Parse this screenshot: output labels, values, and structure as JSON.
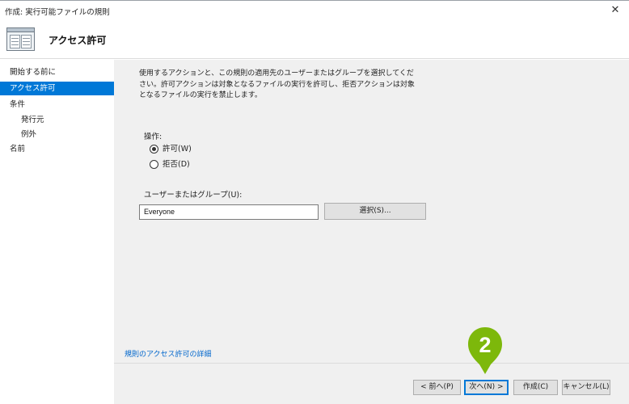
{
  "window": {
    "title": "作成: 実行可能ファイルの規則",
    "close_glyph": "✕"
  },
  "header": {
    "title": "アクセス許可"
  },
  "sidebar": {
    "items": [
      {
        "label": "開始する前に"
      },
      {
        "label": "アクセス許可",
        "active": true
      },
      {
        "label": "条件"
      },
      {
        "label": "発行元"
      },
      {
        "label": "例外"
      },
      {
        "label": "名前"
      }
    ]
  },
  "main": {
    "description": "使用するアクションと、この規則の適用先のユーザーまたはグループを選択してください。許可アクションは対象となるファイルの実行を許可し、拒否アクションは対象となるファイルの実行を禁止します。",
    "action_label": "操作:",
    "actions": [
      {
        "label": "許可(W)",
        "selected": true
      },
      {
        "label": "拒否(D)",
        "selected": false
      }
    ],
    "user_group_label": "ユーザーまたはグループ(U):",
    "user_group_value": "Everyone",
    "select_button": "選択(S)...",
    "detail_link": "規則のアクセス許可の詳細"
  },
  "footer": {
    "prev": "< 前へ(P)",
    "next": "次へ(N) >",
    "create": "作成(C)",
    "cancel": "キャンセル(L)"
  },
  "callout": {
    "number": "2",
    "color": "#7db80b"
  },
  "colors": {
    "accent": "#0078d7",
    "link": "#0066cc",
    "panel": "#f0f0f0"
  }
}
